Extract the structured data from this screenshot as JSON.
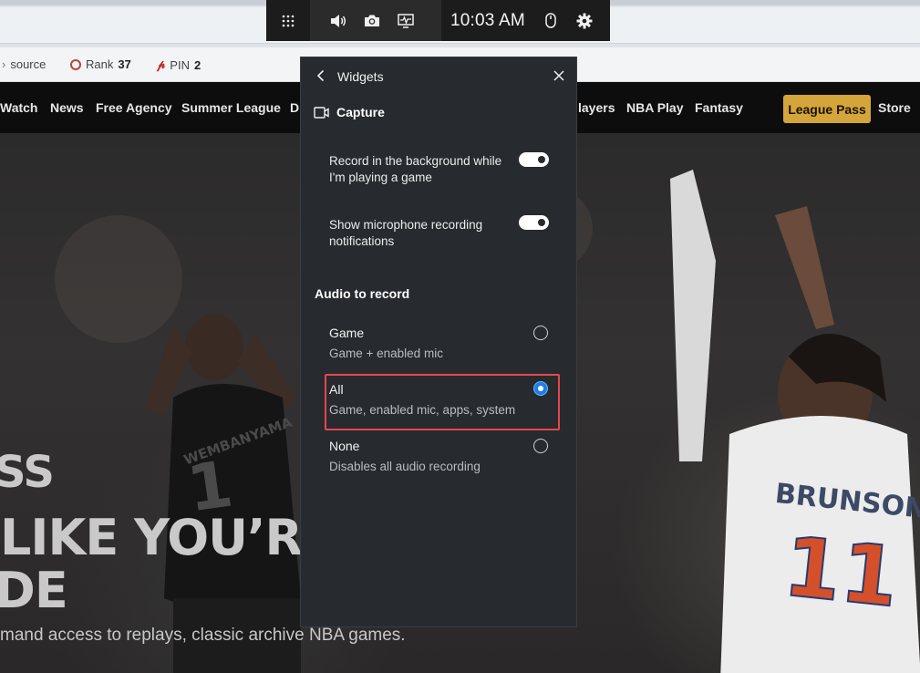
{
  "bookmarks": [
    {
      "icon": "source-icon",
      "label": "source",
      "value": ""
    },
    {
      "icon": "rank-circle-icon",
      "label": "Rank",
      "value": "37"
    },
    {
      "icon": "pinterest-icon",
      "label": "PIN",
      "value": "2"
    }
  ],
  "site_nav": {
    "items": [
      "Watch",
      "News",
      "Free Agency",
      "Summer League",
      "Dr",
      "layers",
      "NBA Play",
      "Fantasy"
    ],
    "league_pass": "League Pass",
    "store": "Store"
  },
  "hero": {
    "line1": "SS",
    "line2": "LIKE YOU’RE",
    "line3": "DE",
    "subtitle": "mand access to replays, classic archive NBA games."
  },
  "game_bar": {
    "time": "10:03 AM",
    "icons": [
      "widget-menu-icon",
      "volume-icon",
      "camera-icon",
      "performance-icon",
      "mouse-icon",
      "settings-icon"
    ]
  },
  "widgets_panel": {
    "title": "Widgets",
    "section": "Capture",
    "settings": [
      {
        "label": "Record in the background while I'm playing a game",
        "on": true
      },
      {
        "label": "Show microphone recording notifications",
        "on": true
      }
    ],
    "audio_heading": "Audio to record",
    "audio_options": [
      {
        "title": "Game",
        "desc": "Game + enabled mic",
        "selected": false
      },
      {
        "title": "All",
        "desc": "Game, enabled mic, apps, system",
        "selected": true
      },
      {
        "title": "None",
        "desc": "Disables all audio recording",
        "selected": false
      }
    ],
    "accent_color": "#1d7fe0",
    "highlight_color": "#e5484d"
  },
  "brand_colors": {
    "league_pass": "#d4a53a"
  }
}
